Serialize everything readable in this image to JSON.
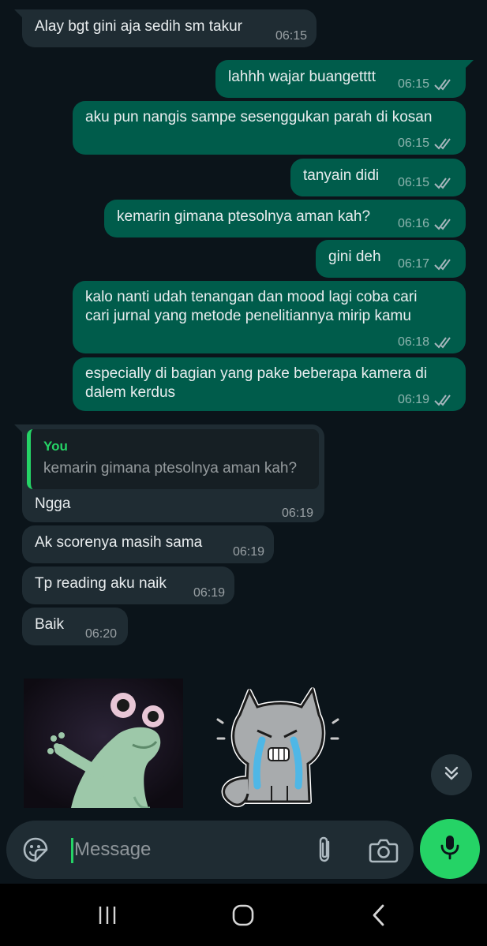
{
  "messages": [
    {
      "dir": "in",
      "lines": [
        "Alay bgt gini aja sedih sm takur"
      ],
      "time": "06:15"
    },
    {
      "dir": "out",
      "lines": [
        "lahhh wajar buangetttt"
      ],
      "time": "06:15"
    },
    {
      "dir": "out",
      "lines": [
        "aku pun nangis sampe sesenggukan parah di kosan"
      ],
      "time": "06:15"
    },
    {
      "dir": "out",
      "lines": [
        "tanyain didi"
      ],
      "time": "06:15"
    },
    {
      "dir": "out",
      "lines": [
        "kemarin gimana ptesolnya aman kah?"
      ],
      "time": "06:16"
    },
    {
      "dir": "out",
      "lines": [
        "gini deh"
      ],
      "time": "06:17"
    },
    {
      "dir": "out",
      "lines": [
        "kalo nanti udah tenangan dan mood lagi coba cari",
        "cari jurnal yang metode penelitiannya mirip kamu"
      ],
      "time": "06:18"
    },
    {
      "dir": "out",
      "lines": [
        "especially di bagian yang pake beberapa kamera di",
        "dalem kerdus"
      ],
      "time": "06:19"
    },
    {
      "dir": "in",
      "quote": {
        "author": "You",
        "text": "kemarin gimana ptesolnya aman kah?"
      },
      "lines": [
        "Ngga"
      ],
      "time": "06:19"
    },
    {
      "dir": "in",
      "lines": [
        "Ak scorenya masih sama"
      ],
      "time": "06:19"
    },
    {
      "dir": "in",
      "lines": [
        "Tp reading aku naik"
      ],
      "time": "06:19"
    },
    {
      "dir": "in",
      "lines": [
        "Baik"
      ],
      "time": "06:20"
    }
  ],
  "composer": {
    "placeholder": "Message"
  },
  "colors": {
    "background": "#0b141a",
    "incoming_bubble": "#1f2c33",
    "outgoing_bubble": "#005c4b",
    "accent": "#25d366"
  },
  "icons": {
    "emoji": "sticker-smiley-icon",
    "attach": "paperclip-icon",
    "camera": "camera-icon",
    "mic": "microphone-icon",
    "scroll": "double-chevron-down-icon",
    "read": "double-check-icon"
  }
}
